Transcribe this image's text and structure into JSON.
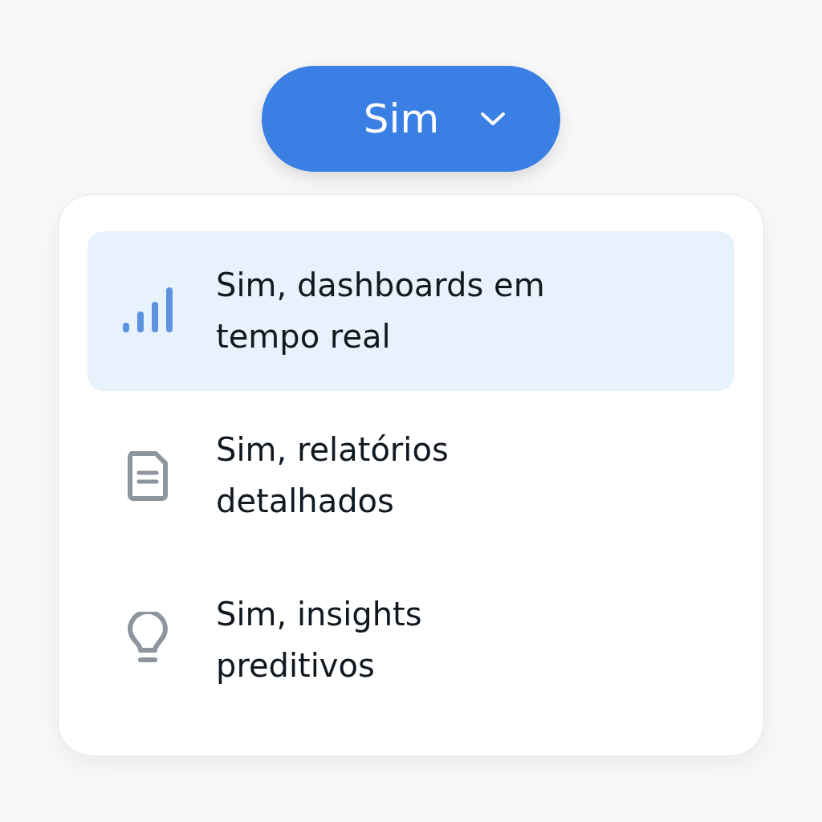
{
  "button": {
    "label": "Sim",
    "expanded": true
  },
  "options": [
    {
      "kind": "chart",
      "label": "Sim, dashboards em tempo real",
      "selected": true
    },
    {
      "kind": "document",
      "label": "Sim, relatórios detalhados",
      "selected": false
    },
    {
      "kind": "bulb",
      "label": "Sim, insights preditivos",
      "selected": false
    }
  ]
}
